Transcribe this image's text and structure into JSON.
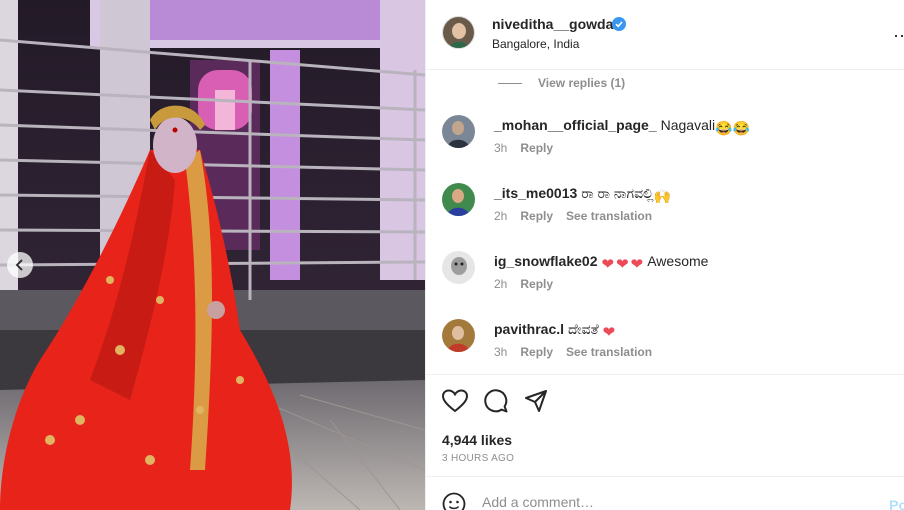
{
  "post": {
    "author": "niveditha__gowda",
    "location": "Bangalore, India",
    "likes": "4,944 likes",
    "time_ago": "3 HOURS AGO"
  },
  "view_replies": "View replies (1)",
  "comments": [
    {
      "user": "_mohan__official_page_",
      "text": "Nagavali",
      "emoji": "😂😂",
      "time": "3h",
      "reply": "Reply",
      "translate": ""
    },
    {
      "user": "_its_me0013",
      "text": "ರಾ ರಾ ನಾಗವಲ್ಲಿ",
      "emoji": "🙌",
      "time": "2h",
      "reply": "Reply",
      "translate": "See translation"
    },
    {
      "user": "ig_snowflake02",
      "text": "Awesome",
      "emoji": "❤❤❤",
      "time": "2h",
      "reply": "Reply",
      "translate": ""
    },
    {
      "user": "pavithrac.l",
      "text": "ದೇವತೆ",
      "emoji": "❤",
      "time": "3h",
      "reply": "Reply",
      "translate": "See translation"
    }
  ],
  "comment_box": {
    "placeholder": "Add a comment…",
    "post_label": "Po"
  },
  "colors": {
    "verified": "#3897f0",
    "heart": "#ed4956",
    "post_button": "#b2dffc"
  },
  "icons": [
    "verified-badge-icon",
    "heart-icon",
    "comment-icon",
    "share-icon",
    "bookmark-icon",
    "smiley-icon",
    "chevron-left-icon"
  ]
}
